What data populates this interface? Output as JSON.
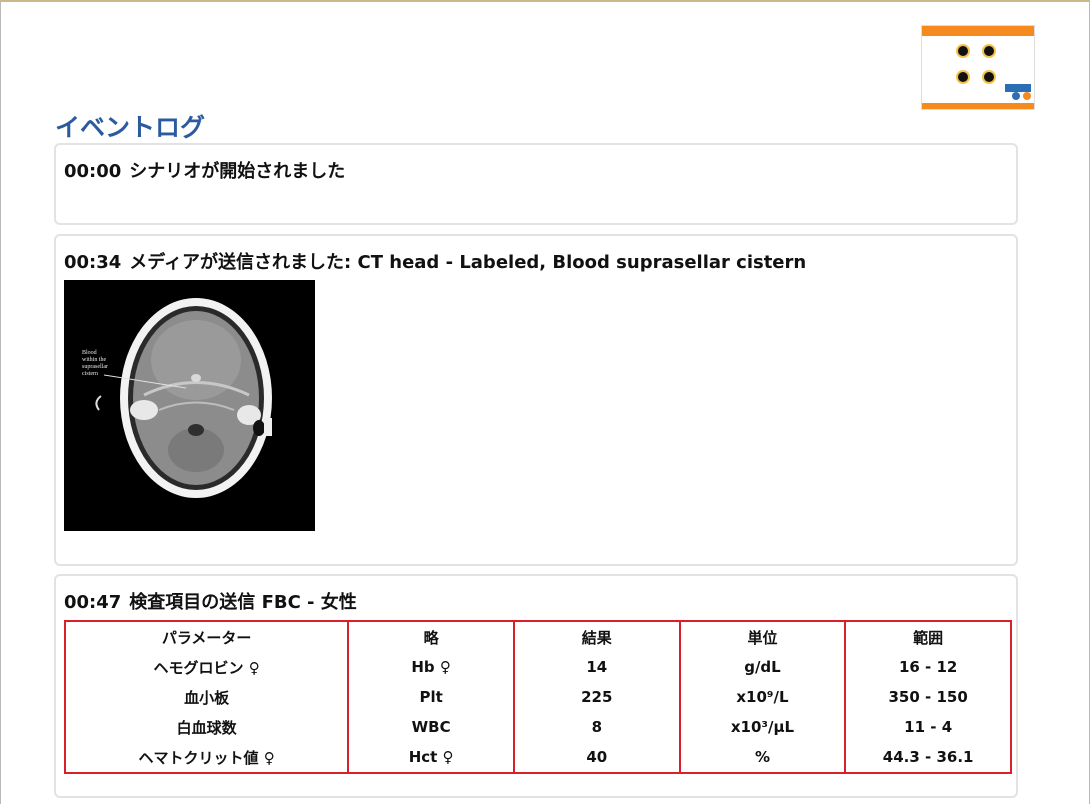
{
  "page": {
    "title": "イベントログ"
  },
  "colors": {
    "title": "#2b5aa0",
    "table_border": "#d8202a",
    "thumb_accent": "#f58a1f"
  },
  "events": [
    {
      "time": "00:00",
      "text": "シナリオが開始されました"
    },
    {
      "time": "00:34",
      "text": "メディアが送信されました: CT head - Labeled, Blood suprasellar cistern",
      "image": {
        "annotation": [
          "Blood",
          "within the",
          "suprasellar",
          "cistern"
        ]
      }
    },
    {
      "time": "00:47",
      "text": "検査項目の送信 FBC - 女性",
      "table": {
        "headers": [
          "パラメーター",
          "略",
          "結果",
          "単位",
          "範囲"
        ],
        "rows": [
          [
            "ヘモグロビン ♀",
            "Hb ♀",
            "14",
            "g/dL",
            "16 - 12"
          ],
          [
            "血小板",
            "Plt",
            "225",
            "x10⁹/L",
            "350 - 150"
          ],
          [
            "白血球数",
            "WBC",
            "8",
            "x10³/µL",
            "11 - 4"
          ],
          [
            "ヘマトクリット値 ♀",
            "Hct ♀",
            "40",
            "%",
            "44.3 - 36.1"
          ]
        ]
      }
    }
  ]
}
